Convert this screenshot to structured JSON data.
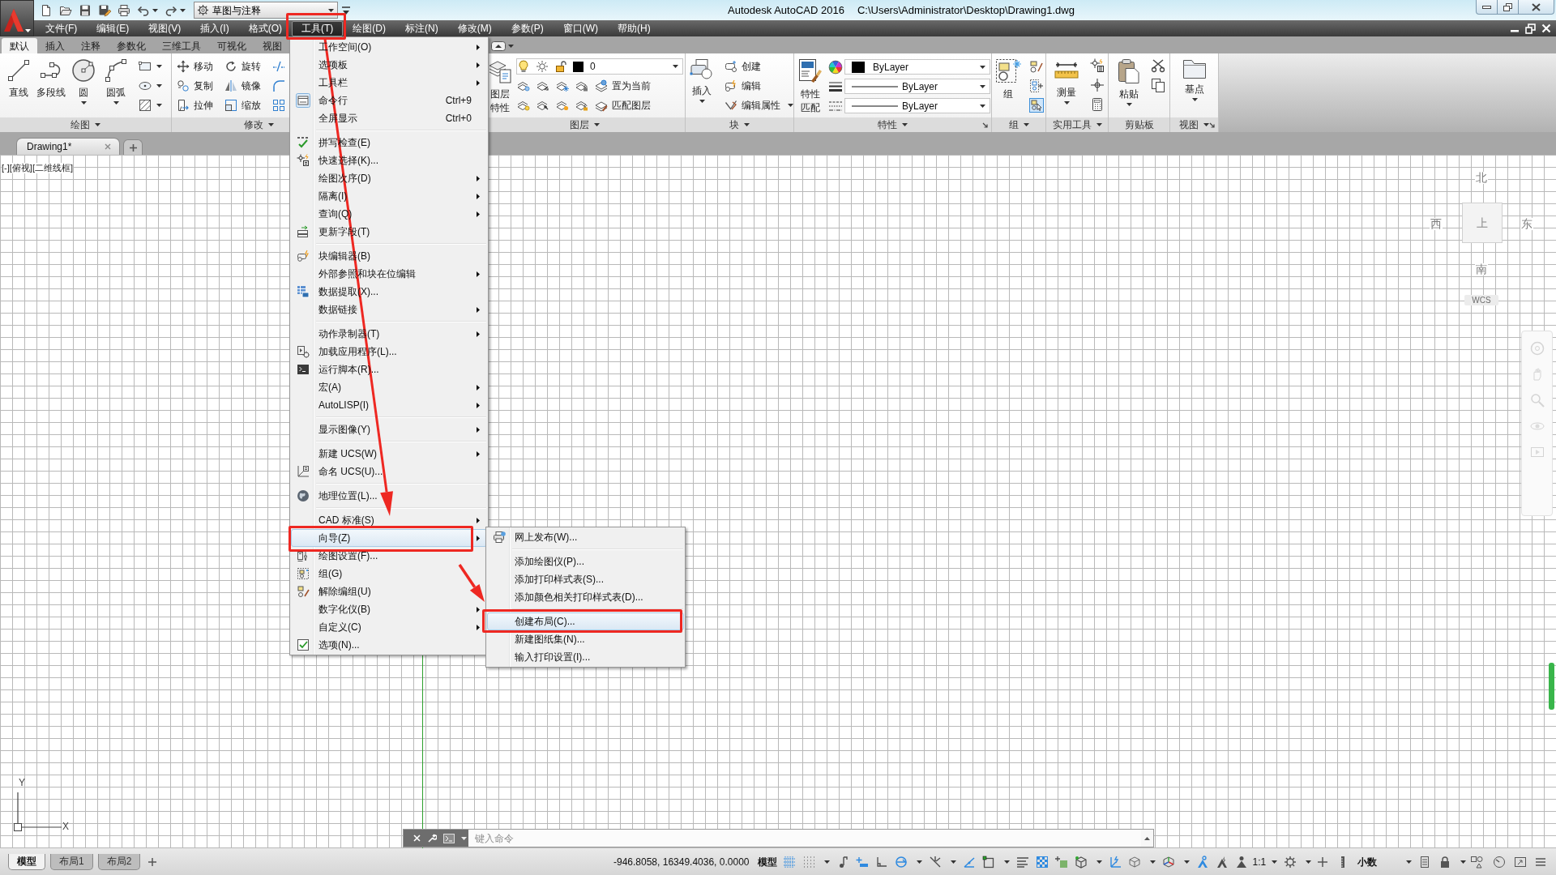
{
  "title_bar": {
    "workspace": "草图与注释",
    "app_title": "Autodesk AutoCAD 2016",
    "file_path": "C:\\Users\\Administrator\\Desktop\\Drawing1.dwg"
  },
  "menu_bar": [
    {
      "label": "文件(F)",
      "selected": false
    },
    {
      "label": "编辑(E)",
      "selected": false
    },
    {
      "label": "视图(V)",
      "selected": false
    },
    {
      "label": "插入(I)",
      "selected": false
    },
    {
      "label": "格式(O)",
      "selected": false
    },
    {
      "label": "工具(T)",
      "selected": true
    },
    {
      "label": "绘图(D)",
      "selected": false
    },
    {
      "label": "标注(N)",
      "selected": false
    },
    {
      "label": "修改(M)",
      "selected": false
    },
    {
      "label": "参数(P)",
      "selected": false
    },
    {
      "label": "窗口(W)",
      "selected": false
    },
    {
      "label": "帮助(H)",
      "selected": false
    }
  ],
  "tools_menu": {
    "groups": [
      {
        "items": [
          {
            "label": "工作空间(O)",
            "submenu": true,
            "selected": false
          },
          {
            "label": "选项板",
            "submenu": true,
            "selected": false
          },
          {
            "label": "工具栏",
            "submenu": true,
            "selected": false
          },
          {
            "label": "命令行",
            "shortcut": "Ctrl+9",
            "submenu": false,
            "selected": false
          },
          {
            "label": "全屏显示",
            "shortcut": "Ctrl+0",
            "submenu": false,
            "selected": false
          }
        ]
      },
      {
        "items": [
          {
            "label": "拼写检查(E)",
            "submenu": false,
            "selected": false
          },
          {
            "label": "快速选择(K)...",
            "submenu": false,
            "selected": false
          },
          {
            "label": "绘图次序(D)",
            "submenu": true,
            "selected": false
          },
          {
            "label": "隔离(I)",
            "submenu": true,
            "selected": false
          },
          {
            "label": "查询(Q)",
            "submenu": true,
            "selected": false
          },
          {
            "label": "更新字段(T)",
            "submenu": false,
            "selected": false
          }
        ]
      },
      {
        "items": [
          {
            "label": "块编辑器(B)",
            "submenu": false,
            "selected": false
          },
          {
            "label": "外部参照和块在位编辑",
            "submenu": true,
            "selected": false
          },
          {
            "label": "数据提取(X)...",
            "submenu": false,
            "selected": false
          },
          {
            "label": "数据链接",
            "submenu": true,
            "selected": false
          }
        ]
      },
      {
        "items": [
          {
            "label": "动作录制器(T)",
            "submenu": true,
            "selected": false
          },
          {
            "label": "加载应用程序(L)...",
            "submenu": false,
            "selected": false
          },
          {
            "label": "运行脚本(R)...",
            "submenu": false,
            "selected": false
          },
          {
            "label": "宏(A)",
            "submenu": true,
            "selected": false
          },
          {
            "label": "AutoLISP(I)",
            "submenu": true,
            "selected": false
          }
        ]
      },
      {
        "items": [
          {
            "label": "显示图像(Y)",
            "submenu": true,
            "selected": false
          }
        ]
      },
      {
        "items": [
          {
            "label": "新建 UCS(W)",
            "submenu": true,
            "selected": false
          },
          {
            "label": "命名 UCS(U)...",
            "submenu": false,
            "selected": false
          }
        ]
      },
      {
        "items": [
          {
            "label": "地理位置(L)...",
            "submenu": false,
            "selected": false
          }
        ]
      },
      {
        "items": [
          {
            "label": "CAD 标准(S)",
            "submenu": true,
            "selected": false
          },
          {
            "label": "向导(Z)",
            "submenu": true,
            "selected": true
          },
          {
            "label": "绘图设置(F)...",
            "submenu": false,
            "selected": false
          },
          {
            "label": "组(G)",
            "submenu": false,
            "selected": false
          },
          {
            "label": "解除编组(U)",
            "submenu": false,
            "selected": false
          },
          {
            "label": "数字化仪(B)",
            "submenu": true,
            "selected": false
          },
          {
            "label": "自定义(C)",
            "submenu": true,
            "selected": false
          },
          {
            "label": "选项(N)...",
            "submenu": false,
            "selected": false
          }
        ]
      }
    ]
  },
  "wizard_submenu": {
    "groups": [
      {
        "items": [
          {
            "label": "网上发布(W)...",
            "selected": false
          }
        ]
      },
      {
        "items": [
          {
            "label": "添加绘图仪(P)...",
            "selected": false
          },
          {
            "label": "添加打印样式表(S)...",
            "selected": false
          },
          {
            "label": "添加颜色相关打印样式表(D)...",
            "selected": false
          }
        ]
      },
      {
        "items": [
          {
            "label": "创建布局(C)...",
            "selected": true
          },
          {
            "label": "新建图纸集(N)...",
            "selected": false
          },
          {
            "label": "输入打印设置(I)...",
            "selected": false
          }
        ]
      }
    ]
  },
  "ribbon_tabs": [
    {
      "label": "默认",
      "selected": true
    },
    {
      "label": "插入",
      "selected": false
    },
    {
      "label": "注释",
      "selected": false
    },
    {
      "label": "参数化",
      "selected": false
    },
    {
      "label": "三维工具",
      "selected": false
    },
    {
      "label": "可视化",
      "selected": false
    },
    {
      "label": "视图",
      "selected": false
    }
  ],
  "ribbon_panels": [
    {
      "kind": "draw",
      "title": "绘图",
      "expandable": true,
      "launcher": false,
      "tools": [
        {
          "label": "直线",
          "dropdown": false
        },
        {
          "label": "多段线",
          "dropdown": false
        },
        {
          "label": "圆",
          "dropdown": true
        },
        {
          "label": "圆弧",
          "dropdown": true
        }
      ]
    },
    {
      "kind": "modify",
      "title": "修改",
      "expandable": true,
      "launcher": false,
      "tools": [
        {
          "label": "移动"
        },
        {
          "label": "旋转"
        },
        {
          "label": "复制"
        },
        {
          "label": "镜像"
        },
        {
          "label": "拉伸"
        },
        {
          "label": "缩放"
        }
      ]
    },
    {
      "kind": "layers",
      "title": "图层",
      "expandable": true,
      "launcher": false,
      "main_tool": {
        "label": "图层特性"
      },
      "current_layer": "0",
      "tools": [
        {
          "label": "置为当前"
        },
        {
          "label": "匹配图层"
        }
      ]
    },
    {
      "kind": "block",
      "title": "块",
      "expandable": true,
      "launcher": false,
      "main_tool": {
        "label": "插入",
        "dropdown": true
      },
      "tools": [
        {
          "label": "创建",
          "dropdown": false
        },
        {
          "label": "编辑",
          "dropdown": false
        },
        {
          "label": "编辑属性",
          "dropdown": true
        }
      ]
    },
    {
      "kind": "properties",
      "title": "特性",
      "expandable": true,
      "launcher": true,
      "main_tool": {
        "label": "特性匹配"
      },
      "color_setting": "ByLayer",
      "lineweight": "ByLayer",
      "linetype": "ByLayer"
    },
    {
      "kind": "group",
      "title": "组",
      "expandable": true,
      "launcher": false,
      "main_tool": {
        "label": "组",
        "dropdown": false
      },
      "selection_toggle": {
        "on": true
      }
    },
    {
      "kind": "utilities",
      "title": "实用工具",
      "expandable": true,
      "launcher": false,
      "main_tool": {
        "label": "测量",
        "dropdown": true
      }
    },
    {
      "kind": "clipboard",
      "title": "剪贴板",
      "expandable": false,
      "launcher": false,
      "main_tool": {
        "label": "粘贴",
        "dropdown": true
      }
    },
    {
      "kind": "view",
      "title": "视图",
      "expandable": true,
      "launcher": true,
      "main_tool": {
        "label": "基点",
        "dropdown": true
      }
    }
  ],
  "document_tabs": [
    {
      "label": "Drawing1*",
      "selected": true
    }
  ],
  "viewport": {
    "controls": "[-][俯视][二维线框]",
    "view_cube": {
      "north": "北",
      "west": "西",
      "top": "上",
      "east": "东",
      "south": "南",
      "coordinate_system": "WCS"
    },
    "ucs_icon": {
      "x": "X",
      "y": "Y"
    }
  },
  "command_line": {
    "placeholder": "键入命令"
  },
  "layout_tabs": [
    {
      "label": "模型",
      "selected": true
    },
    {
      "label": "布局1",
      "selected": false
    },
    {
      "label": "布局2",
      "selected": false
    }
  ],
  "status_bar": {
    "coordinates": "-946.8058, 16349.4036, 0.0000",
    "space": "模型",
    "toggles": [
      {
        "on": true,
        "dropdown": false
      },
      {
        "on": false,
        "dropdown": true
      },
      {
        "on": false,
        "dropdown": false
      },
      {
        "on": true,
        "dropdown": false
      },
      {
        "on": false,
        "dropdown": false
      },
      {
        "on": true,
        "dropdown": true
      },
      {
        "on": false,
        "dropdown": true
      },
      {
        "on": true,
        "dropdown": false
      },
      {
        "on": false,
        "dropdown": true
      },
      {
        "on": false,
        "dropdown": false
      },
      {
        "on": true,
        "dropdown": false
      },
      {
        "on": false,
        "dropdown": false
      },
      {
        "on": false,
        "dropdown": true
      },
      {
        "on": true,
        "dropdown": false
      },
      {
        "on": false,
        "dropdown": true
      },
      {
        "on": false,
        "dropdown": true
      },
      {
        "on": true,
        "dropdown": false
      },
      {
        "on": false,
        "dropdown": false
      },
      {
        "on": false,
        "dropdown": false
      }
    ],
    "annotation_scale": "1:1",
    "units": "小数"
  }
}
